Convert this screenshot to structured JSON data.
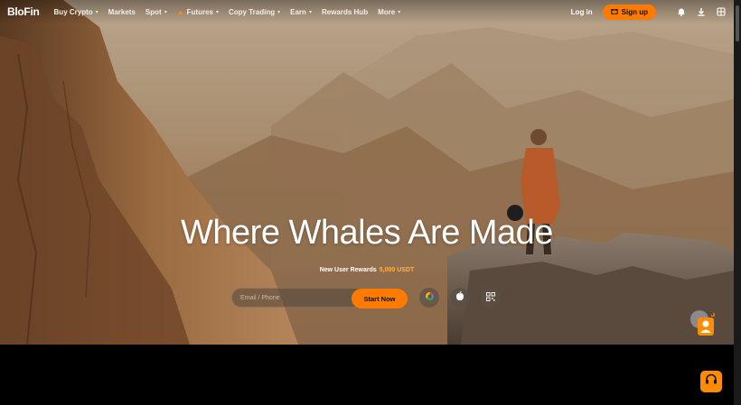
{
  "nav": {
    "logo": "BloFin",
    "items": [
      {
        "label": "Buy Crypto",
        "has_menu": true
      },
      {
        "label": "Markets",
        "has_menu": false
      },
      {
        "label": "Spot",
        "has_menu": true
      },
      {
        "label": "Futures",
        "has_menu": true,
        "icon": "fire-icon"
      },
      {
        "label": "Copy Trading",
        "has_menu": true
      },
      {
        "label": "Earn",
        "has_menu": true
      },
      {
        "label": "Rewards Hub",
        "has_menu": false
      },
      {
        "label": "More",
        "has_menu": true
      }
    ],
    "login_label": "Log in",
    "signup_label": "Sign up",
    "right_icons": [
      "bell-icon",
      "download-icon",
      "globe-icon"
    ]
  },
  "hero": {
    "headline": "Where Whales Are Made",
    "reward_label": "New User Rewards",
    "reward_amount": "5,000 USDT",
    "email_placeholder": "Email / Phone",
    "start_label": "Start Now",
    "social_icons": [
      "google-icon",
      "apple-icon",
      "qr-code-icon"
    ]
  },
  "colors": {
    "accent": "#ff7a00",
    "reward": "#ffb23f"
  }
}
